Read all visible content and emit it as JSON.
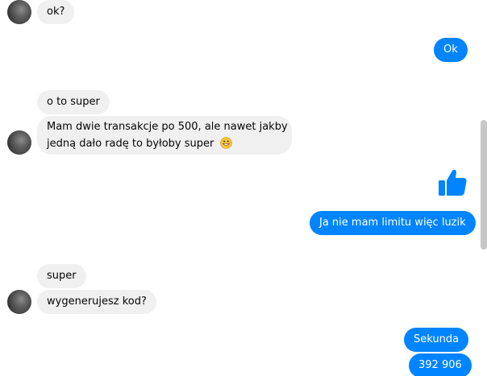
{
  "messages": [
    {
      "direction": "incoming",
      "text": "ok?"
    },
    {
      "direction": "outgoing",
      "text": "Ok"
    },
    {
      "direction": "incoming",
      "text": "o to super"
    },
    {
      "direction": "incoming",
      "text_line1": "Mam dwie transakcje po 500, ale nawet jakby",
      "text_line2": "jedną dało radę to byłoby super",
      "emoji_icon": "grinning-face-icon"
    },
    {
      "direction": "outgoing",
      "sticker_icon": "thumbs-up-icon"
    },
    {
      "direction": "outgoing",
      "text": "Ja nie mam limitu więc luzik"
    },
    {
      "direction": "incoming",
      "text": "super"
    },
    {
      "direction": "incoming",
      "text": "wygenerujesz kod?"
    },
    {
      "direction": "outgoing",
      "text": "Sekunda"
    },
    {
      "direction": "outgoing",
      "text": "392 906"
    }
  ],
  "colors": {
    "outgoing_bubble": "#0084ff",
    "incoming_bubble": "#f0f0f0",
    "thumbs_up": "#0084ff"
  }
}
